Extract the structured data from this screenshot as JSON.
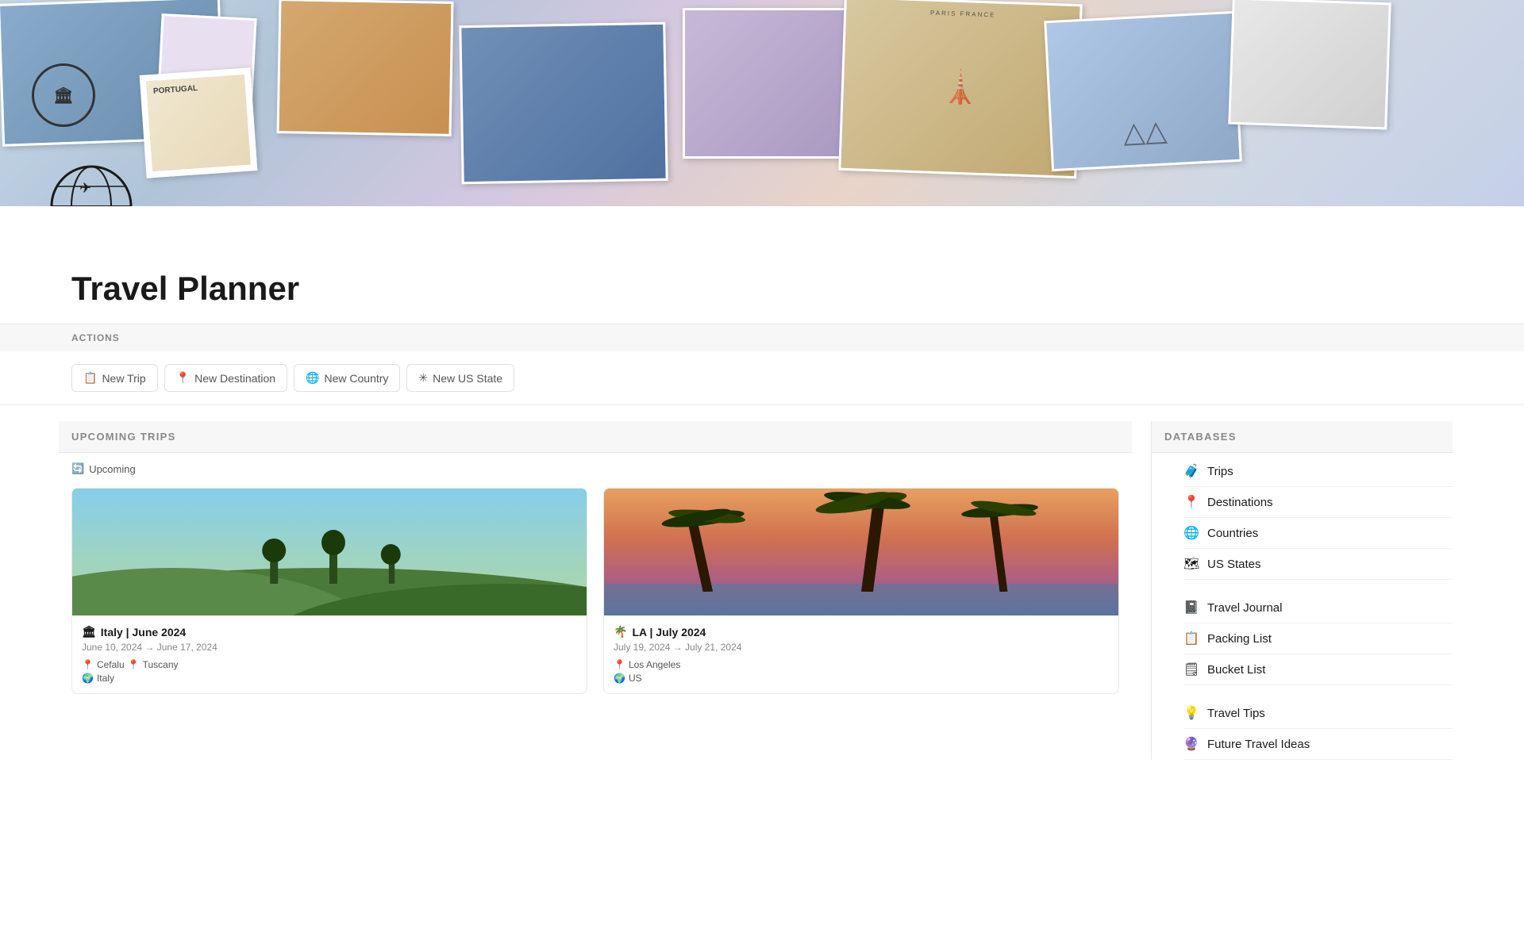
{
  "header": {
    "banner_alt": "Travel collage banner"
  },
  "page": {
    "icon": "🌍",
    "title": "Travel Planner"
  },
  "actions": {
    "label": "ACTIONS",
    "buttons": [
      {
        "id": "new-trip",
        "icon": "📋",
        "label": "New Trip"
      },
      {
        "id": "new-destination",
        "icon": "📍",
        "label": "New Destination"
      },
      {
        "id": "new-country",
        "icon": "🌐",
        "label": "New Country"
      },
      {
        "id": "new-us-state",
        "icon": "✳",
        "label": "New US State"
      }
    ]
  },
  "upcoming_trips": {
    "section_label": "UPCOMING TRIPS",
    "filter_label": "Upcoming",
    "trips": [
      {
        "id": "italy",
        "icon": "🏛",
        "title": "Italy | June 2024",
        "dates": "June 10, 2024 → June 17, 2024",
        "tags": [
          {
            "icon": "📍",
            "text": "Cefalu"
          },
          {
            "icon": "📍",
            "text": "Tuscany"
          },
          {
            "icon": "🌍",
            "text": "Italy"
          }
        ]
      },
      {
        "id": "la",
        "icon": "🌴",
        "title": "LA | July 2024",
        "dates": "July 19, 2024 → July 21, 2024",
        "tags": [
          {
            "icon": "📍",
            "text": "Los Angeles"
          },
          {
            "icon": "🌍",
            "text": "US"
          }
        ]
      }
    ]
  },
  "databases": {
    "section_label": "DATABASES",
    "primary": [
      {
        "id": "trips",
        "icon": "🧳",
        "label": "Trips"
      },
      {
        "id": "destinations",
        "icon": "📍",
        "label": "Destinations"
      },
      {
        "id": "countries",
        "icon": "🌐",
        "label": "Countries"
      },
      {
        "id": "us-states",
        "icon": "🗺",
        "label": "US States"
      }
    ],
    "secondary": [
      {
        "id": "travel-journal",
        "icon": "📓",
        "label": "Travel Journal"
      },
      {
        "id": "packing-list",
        "icon": "📋",
        "label": "Packing List"
      },
      {
        "id": "bucket-list",
        "icon": "🗒",
        "label": "Bucket List"
      }
    ],
    "tertiary": [
      {
        "id": "travel-tips",
        "icon": "💡",
        "label": "Travel Tips"
      },
      {
        "id": "future-travel-ideas",
        "icon": "🔮",
        "label": "Future Travel Ideas"
      }
    ]
  }
}
